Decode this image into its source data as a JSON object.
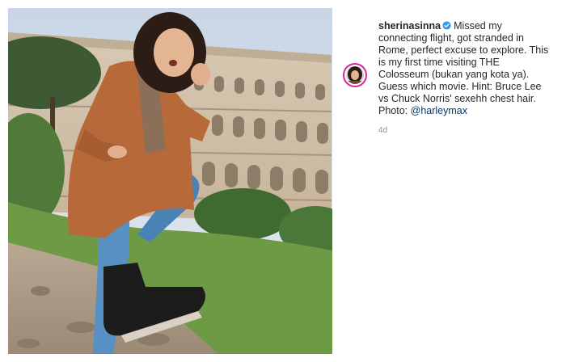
{
  "post": {
    "username": "sherinasinna",
    "caption_text": "Missed my connecting flight, got stranded in Rome, perfect excuse to explore. This is my first time visiting THE Colosseum (bukan yang kota ya). Guess which movie. Hint: Bruce Lee vs Chuck Norris' sexehh chest hair. Photo: ",
    "mention": "@harleymax",
    "timestamp": "4d",
    "verified_icon": "verified-badge-icon",
    "accent_colors": {
      "verified": "#3897f0",
      "mention": "#00376b",
      "avatar_ring": "#d6249f",
      "muted": "#8e8e8e"
    }
  }
}
